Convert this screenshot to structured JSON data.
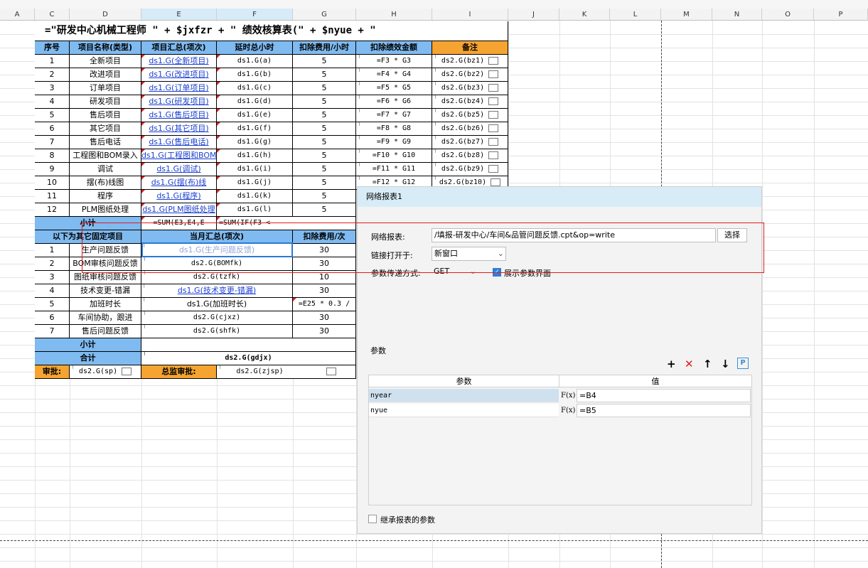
{
  "sheet": {
    "columns": [
      "A",
      "C",
      "D",
      "E",
      "F",
      "G",
      "H",
      "I",
      "J",
      "K",
      "L",
      "M",
      "N",
      "O",
      "P"
    ],
    "title_formula": "=\"研发中心机械工程师 \" + $jxfzr + \" 绩效核算表(\" + $nyue + \"",
    "headers": {
      "no": "序号",
      "name": "项目名称(类型)",
      "summary": "项目汇总(项次)",
      "delay": "延时总小时",
      "deduct_hour": "扣除费用/小时",
      "deduct_amount": "扣除绩效金额",
      "remark": "备注"
    },
    "rows": [
      {
        "no": "1",
        "name": "全新项目",
        "summary": "ds1.G(全新项目)",
        "delay": "ds1.G(a)",
        "rate": "5",
        "formula": "=F3 * G3",
        "remark": "ds2.G(bz1)"
      },
      {
        "no": "2",
        "name": "改进项目",
        "summary": "ds1.G(改进项目)",
        "delay": "ds1.G(b)",
        "rate": "5",
        "formula": "=F4 * G4",
        "remark": "ds2.G(bz2)"
      },
      {
        "no": "3",
        "name": "订单项目",
        "summary": "ds1.G(订单项目)",
        "delay": "ds1.G(c)",
        "rate": "5",
        "formula": "=F5 * G5",
        "remark": "ds2.G(bz3)"
      },
      {
        "no": "4",
        "name": "研发项目",
        "summary": "ds1.G(研发项目)",
        "delay": "ds1.G(d)",
        "rate": "5",
        "formula": "=F6 * G6",
        "remark": "ds2.G(bz4)"
      },
      {
        "no": "5",
        "name": "售后项目",
        "summary": "ds1.G(售后项目)",
        "delay": "ds1.G(e)",
        "rate": "5",
        "formula": "=F7 * G7",
        "remark": "ds2.G(bz5)"
      },
      {
        "no": "6",
        "name": "其它项目",
        "summary": "ds1.G(其它项目)",
        "delay": "ds1.G(f)",
        "rate": "5",
        "formula": "=F8 * G8",
        "remark": "ds2.G(bz6)"
      },
      {
        "no": "7",
        "name": "售后电话",
        "summary": "ds1.G(售后电话)",
        "delay": "ds1.G(g)",
        "rate": "5",
        "formula": "=F9 * G9",
        "remark": "ds2.G(bz7)"
      },
      {
        "no": "8",
        "name": "工程图和BOM录入",
        "summary": "ds1.G(工程图和BOM",
        "delay": "ds1.G(h)",
        "rate": "5",
        "formula": "=F10 * G10",
        "remark": "ds2.G(bz8)"
      },
      {
        "no": "9",
        "name": "调试",
        "summary": "ds1.G(调试)",
        "delay": "ds1.G(i)",
        "rate": "5",
        "formula": "=F11 * G11",
        "remark": "ds2.G(bz9)"
      },
      {
        "no": "10",
        "name": "摆(布)线图",
        "summary": "ds1.G(摆(布)线",
        "delay": "ds1.G(j)",
        "rate": "5",
        "formula": "=F12 * G12",
        "remark": "ds2.G(bz10)"
      },
      {
        "no": "11",
        "name": "程序",
        "summary": "ds1.G(程序)",
        "delay": "ds1.G(k)",
        "rate": "5",
        "formula": "",
        "remark": ""
      },
      {
        "no": "12",
        "name": "PLM图纸处理",
        "summary": "ds1.G(PLM图纸处理",
        "delay": "ds1.G(l)",
        "rate": "5",
        "formula": "",
        "remark": ""
      }
    ],
    "subtotal_label": "小计",
    "subtotal_e": "=SUM(E3,E4,E",
    "subtotal_f": "=SUM(IF(F3 <",
    "fixed_headers": {
      "name": "以下为其它固定项目",
      "summary": "当月汇总(项次)",
      "deduct": "扣除费用/次"
    },
    "fixed_rows": [
      {
        "no": "1",
        "name": "生产问题反馈",
        "summary": "ds1.G(生产问题反馈)",
        "rate": "30"
      },
      {
        "no": "2",
        "name": "BOM审核问题反馈",
        "summary": "ds2.G(BOMfk)",
        "rate": "30"
      },
      {
        "no": "3",
        "name": "图纸审核问题反馈",
        "summary": "ds2.G(tzfk)",
        "rate": "10"
      },
      {
        "no": "4",
        "name": "技术变更-错漏",
        "summary": "ds1.G(技术变更-错漏)",
        "rate": "30"
      },
      {
        "no": "5",
        "name": "加班时长",
        "summary": "ds1.G(加班时长)",
        "rate": "=E25 * 0.3 /"
      },
      {
        "no": "6",
        "name": "车间协助，跟进",
        "summary": "ds2.G(cjxz)",
        "rate": "30"
      },
      {
        "no": "7",
        "name": "售后问题反馈",
        "summary": "ds2.G(shfk)",
        "rate": "30"
      }
    ],
    "subtotal2_label": "小计",
    "total_label": "合计",
    "total_value": "ds2.G(gdjx)",
    "approve_label": "审批:",
    "approve_value": "ds2.G(sp)",
    "director_label": "总监审批:",
    "director_value": "ds2.G(zjsp)"
  },
  "dialog": {
    "title": "网络报表1",
    "report_label": "网络报表:",
    "report_value": "/填报-研发中心/车间&品管问题反馈.cpt&op=write",
    "select_button": "选择",
    "open_label": "链接打开于:",
    "open_value": "新窗口",
    "param_method_label": "参数传递方式:",
    "param_method_value": "GET",
    "show_params_label": "展示参数界面",
    "show_params_checked": true,
    "params_label": "参数",
    "table_headers": {
      "param": "参数",
      "value": "值"
    },
    "params": [
      {
        "name": "nyear",
        "value": "=B4"
      },
      {
        "name": "nyue",
        "value": "=B5"
      }
    ],
    "fx_label": "F(x)",
    "inherit_label": "继承报表的参数",
    "inherit_checked": false,
    "toolbar": {
      "add": "+",
      "delete": "✕",
      "up": "↑",
      "down": "↓",
      "param": "P"
    }
  },
  "colors": {
    "header_blue": "#7fbaf0",
    "header_orange": "#f5a431",
    "link_blue": "#1b3fd1",
    "highlight_red": "#e01c1c"
  }
}
